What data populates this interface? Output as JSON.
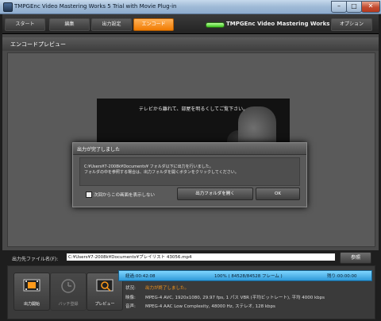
{
  "window": {
    "title": "TMPGEnc Video Mastering Works 5 Trial with Movie Plug-in",
    "minimize": "–",
    "maximize": "□",
    "close": "✕"
  },
  "nav": {
    "tabs": [
      "スタート",
      "編集",
      "出力設定",
      "エンコード"
    ],
    "active_tab": "エンコード",
    "brand": "TMPGEnc Video Mastering Works 5",
    "options": "オプション"
  },
  "panel": {
    "title": "エンコードプレビュー"
  },
  "preview": {
    "message": "テレビから離れて、部屋を明るくしてご覧下さい。"
  },
  "dialog": {
    "title": "出力が完了しました",
    "message_lines": [
      "C:¥Users¥7-2008k¥Documents¥ フォルダ以下に出力を行いました。",
      "フォルダの中を参照する場合は、出力フォルダを開くボタンをクリックしてください。"
    ],
    "checkbox_label": "次回からこの画面を表示しない",
    "open_folder_button": "出力フォルダを開く",
    "ok_button": "OK"
  },
  "output": {
    "label": "出力先ファイル名(F):",
    "path": "C:¥Users¥7-2008k¥Documents¥プレイリスト 43056.mp4",
    "browse_button": "参照"
  },
  "controls": {
    "start_output": "出力開始",
    "batch_register": "バッチ登録",
    "preview": "プレビュー"
  },
  "progress": {
    "elapsed": "経過:00:42:08",
    "percent_text": "100% ( 84528/84528 フレーム )",
    "remaining": "残り:00:00:00",
    "fraction": 1.0
  },
  "info": {
    "status_label": "状況:",
    "status_value": "出力が終了しました。",
    "video_label": "映像:",
    "video_value": "MPEG-4 AVC, 1920x1080, 29.97 fps, 1 パス VBR (平均ビットレート), 平均 4000 kbps",
    "audio_label": "音声:",
    "audio_value": "MPEG-4 AAC Low Complexity, 48000 Hz, ステレオ, 128 kbps"
  },
  "colors": {
    "accent_tab": "#f07a00",
    "progress": "#2f9ad9",
    "status_text": "#ff9a1a"
  }
}
